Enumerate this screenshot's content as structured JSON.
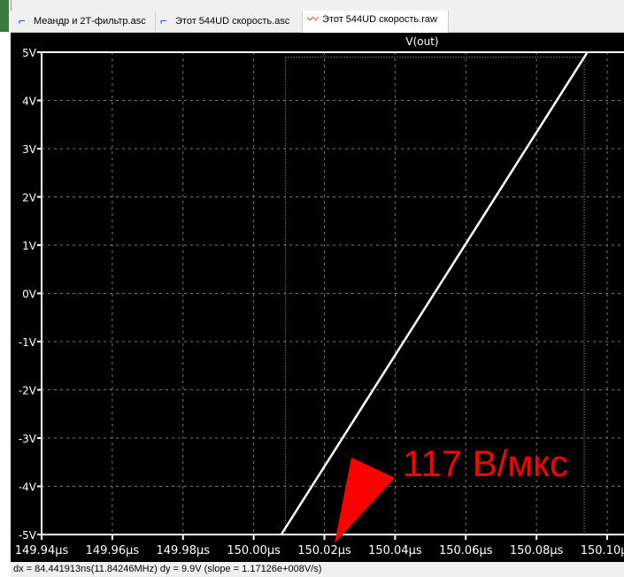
{
  "tabs": [
    {
      "label": "Меандр и 2Т-фильтр.asc",
      "icon": "schematic-icon",
      "active": false
    },
    {
      "label": "Этот 544UD скорость.asc",
      "icon": "schematic-icon",
      "active": false
    },
    {
      "label": "Этот 544UD скорость.raw",
      "icon": "waveform-icon",
      "active": true
    }
  ],
  "plot": {
    "trace_label": "V(out)",
    "trace_color": "#ffffff",
    "background": "#000000"
  },
  "chart_data": {
    "type": "line",
    "title": "V(out)",
    "xlim": [
      149.94,
      150.1
    ],
    "ylim": [
      -5,
      5
    ],
    "x_ticks": [
      "149.94µs",
      "149.96µs",
      "149.98µs",
      "150.00µs",
      "150.02µs",
      "150.04µs",
      "150.06µs",
      "150.08µs",
      "150.10µs"
    ],
    "y_ticks": [
      "5V",
      "4V",
      "3V",
      "2V",
      "1V",
      "0V",
      "-1V",
      "-2V",
      "-3V",
      "-4V",
      "-5V"
    ],
    "grid": true,
    "series": [
      {
        "name": "V(out)",
        "x": [
          150.0078,
          150.0944
        ],
        "y": [
          -5,
          5
        ]
      }
    ],
    "cursors": {
      "x": [
        150.009,
        150.0935
      ],
      "y": [
        -5,
        4.9
      ]
    }
  },
  "annotation": {
    "text": "117 В/мкс",
    "color": "#ff0000"
  },
  "status": {
    "text": "dx = 84.441913ns(11.84246MHz)    dy = 9.9V    (slope = 1.17126e+008V/s)"
  }
}
